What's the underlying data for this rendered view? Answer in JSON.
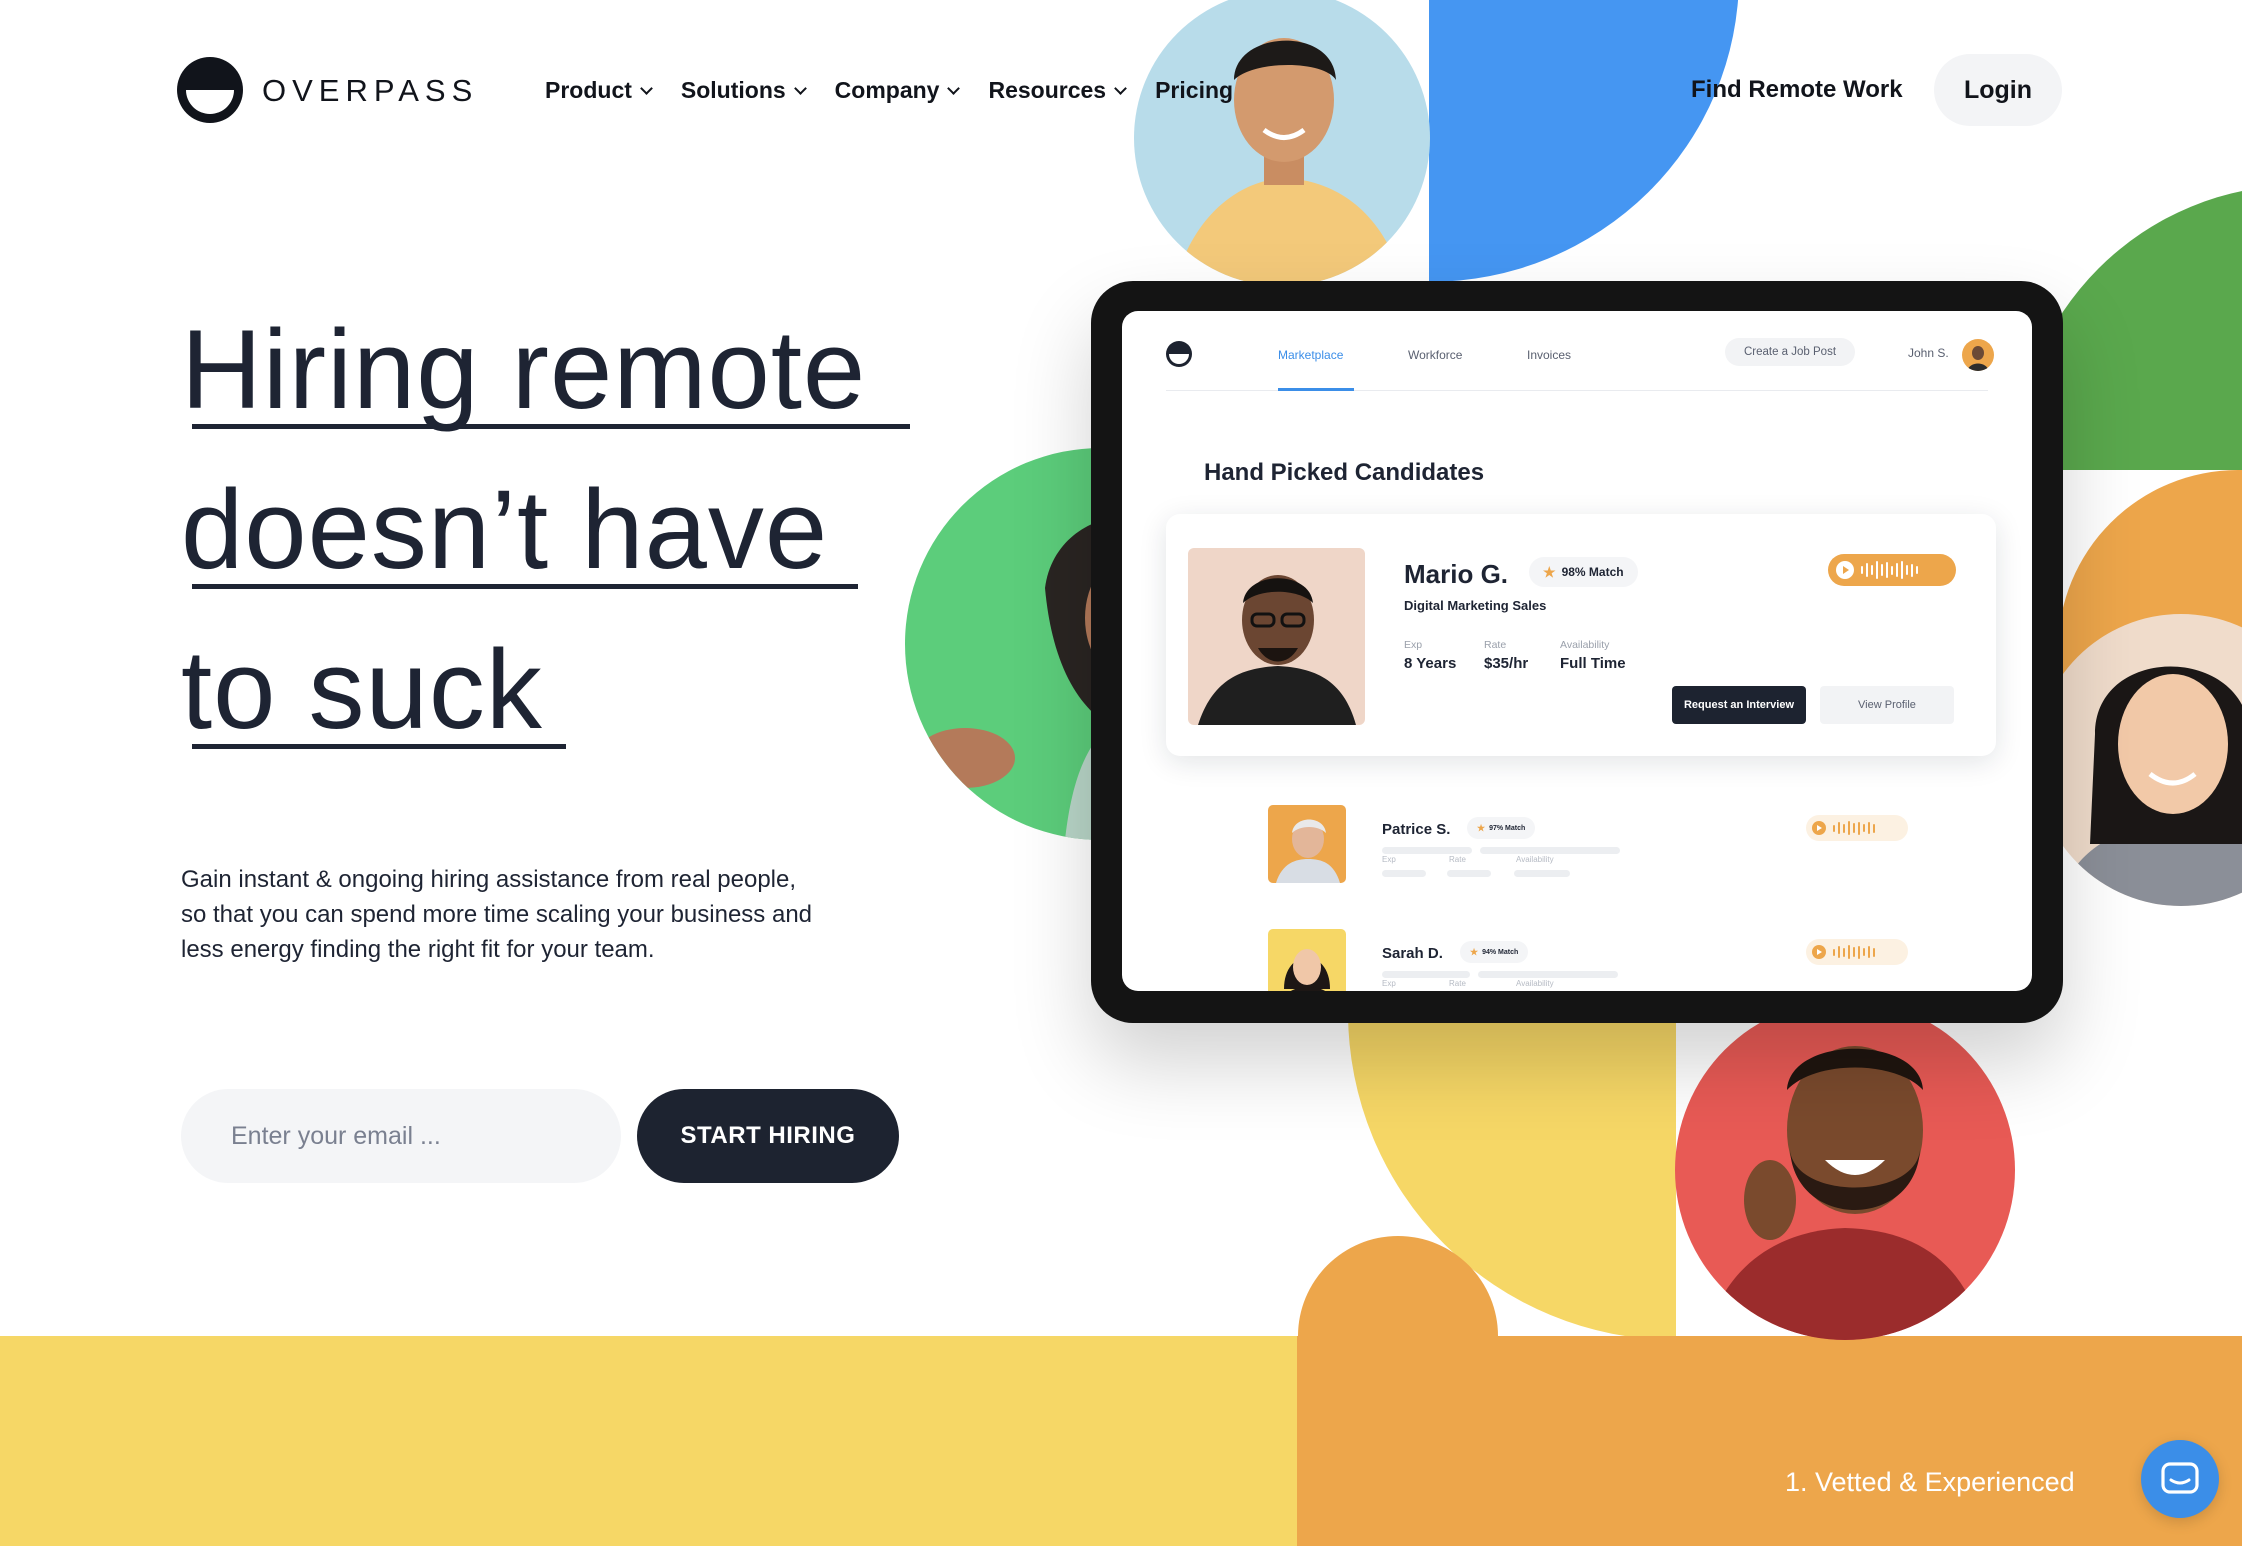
{
  "brand": {
    "name": "OVERPASS"
  },
  "nav": {
    "items": [
      {
        "label": "Product",
        "dropdown": true
      },
      {
        "label": "Solutions",
        "dropdown": true
      },
      {
        "label": "Company",
        "dropdown": true
      },
      {
        "label": "Resources",
        "dropdown": true
      },
      {
        "label": "Pricing",
        "dropdown": false
      }
    ],
    "find_work": "Find Remote Work",
    "login": "Login"
  },
  "hero": {
    "headline_lines": [
      "Hiring remote",
      "doesn’t have",
      "to suck"
    ],
    "subtext": "Gain instant & ongoing hiring assistance from real people, so that you can spend more time scaling your business and less energy finding the right fit for your team.",
    "email_placeholder": "Enter your email ...",
    "cta": "START HIRING"
  },
  "tablet": {
    "tabs": [
      "Marketplace",
      "Workforce",
      "Invoices"
    ],
    "active_tab": "Marketplace",
    "create_job": "Create a Job Post",
    "user": "John S.",
    "section_title": "Hand Picked Candidates",
    "featured": {
      "name": "Mario G.",
      "match": "98% Match",
      "role": "Digital Marketing Sales",
      "stats": [
        {
          "label": "Exp",
          "value": "8 Years"
        },
        {
          "label": "Rate",
          "value": "$35/hr"
        },
        {
          "label": "Availability",
          "value": "Full Time"
        }
      ],
      "request_button": "Request an Interview",
      "view_button": "View Profile"
    },
    "candidates": [
      {
        "name": "Patrice S.",
        "match": "97% Match",
        "labels": [
          "Exp",
          "Rate",
          "Availability"
        ]
      },
      {
        "name": "Sarah D.",
        "match": "94% Match",
        "labels": [
          "Exp",
          "Rate",
          "Availability"
        ]
      }
    ]
  },
  "footer": {
    "feature": "1. Vetted & Experienced"
  },
  "colors": {
    "navy": "#1d2330",
    "blue": "#4596f2",
    "green": "#5aa84d",
    "orange": "#eda64b",
    "yellow": "#f6d766",
    "red": "#e85a55",
    "light_blue": "#b8dcea"
  },
  "icons": [
    "chevron-down-icon",
    "star-icon",
    "play-icon",
    "audio-wave-icon",
    "chat-icon"
  ]
}
